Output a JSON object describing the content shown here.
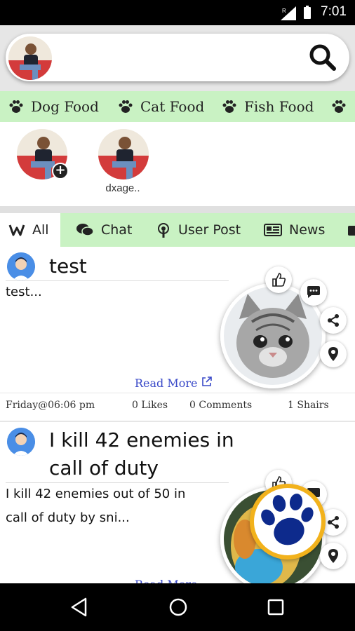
{
  "status_bar": {
    "time": "7:01"
  },
  "categories": [
    {
      "label": "Dog Food"
    },
    {
      "label": "Cat Food"
    },
    {
      "label": "Fish Food"
    }
  ],
  "stories": [
    {
      "name": ""
    },
    {
      "name": "dxage.."
    }
  ],
  "tabs": [
    {
      "label": "All",
      "icon": "wechat-like-all-icon",
      "active": true
    },
    {
      "label": "Chat",
      "icon": "chat-bubbles-icon"
    },
    {
      "label": "User Post",
      "icon": "podcast-icon"
    },
    {
      "label": "News",
      "icon": "newspaper-icon"
    }
  ],
  "posts": [
    {
      "title": "test",
      "body": "test...",
      "read_more": "Read More",
      "date": "Friday@06:06 pm",
      "likes": "0 Likes",
      "comments": "0 Comments",
      "shares": "1 Shairs"
    },
    {
      "title_line1": "I kill 42 enemies in",
      "title_line2": "call of duty",
      "body_line1": "I kill 42 enemies out of 50 in",
      "body_line2": "call of duty by sni...",
      "read_more": "Read More"
    }
  ],
  "colors": {
    "category_bg": "#c9f2c3",
    "link": "#3949c8",
    "avatar_blue": "#4a8ee6",
    "badge_ring": "#f2b21c",
    "badge_paw": "#0d2a8c"
  }
}
